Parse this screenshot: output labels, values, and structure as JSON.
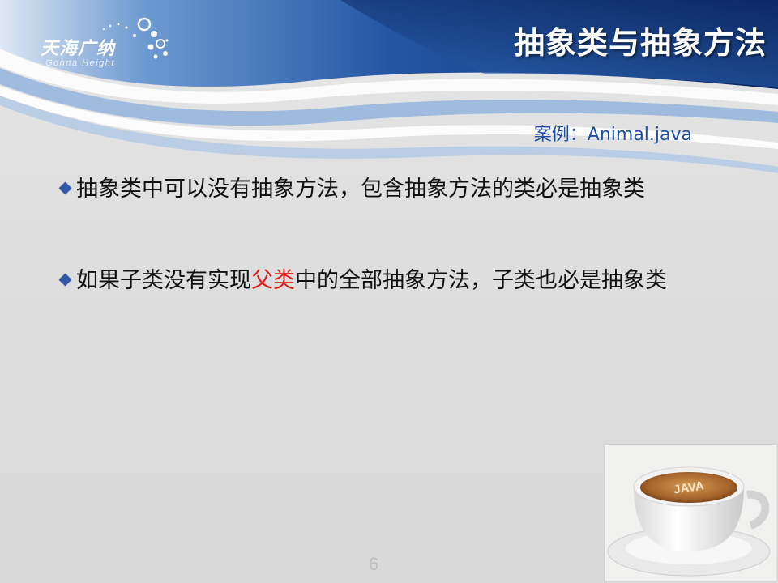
{
  "header": {
    "logo_cn": "天海广纳",
    "logo_en": "Gonna Height",
    "title": "抽象类与抽象方法",
    "colors": {
      "dark_blue": "#0f2b66",
      "mid_blue": "#2a5aa8",
      "light_blue": "#8fb4df"
    }
  },
  "example_label": "案例：Animal.java",
  "bullets": [
    {
      "text": "抽象类中可以没有抽象方法，包含抽象方法的类必是抽象类"
    },
    {
      "text_before": "如果子类没有实现",
      "highlight": "父类",
      "text_after": "中的全部抽象方法，子类也必是抽象类",
      "highlight_color": "#e41a1a"
    }
  ],
  "page_number": "6",
  "image": {
    "description_icon": "coffee-cup-image",
    "cup_text": "JAVA"
  }
}
